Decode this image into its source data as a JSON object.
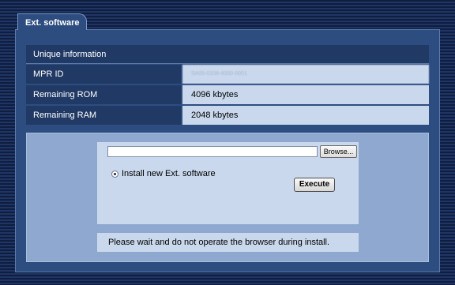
{
  "tab": {
    "label": "Ext. software"
  },
  "info": {
    "header": "Unique information",
    "rows": [
      {
        "label": "MPR ID",
        "value": "SA05-0106-4000-0001"
      },
      {
        "label": "Remaining ROM",
        "value": "4096 kbytes"
      },
      {
        "label": "Remaining RAM",
        "value": "2048 kbytes"
      }
    ]
  },
  "install": {
    "file_value": "",
    "browse_label": "Browse...",
    "option_label": "Install new Ext. software",
    "execute_label": "Execute",
    "notice": "Please wait and do not operate the browser during install."
  }
}
